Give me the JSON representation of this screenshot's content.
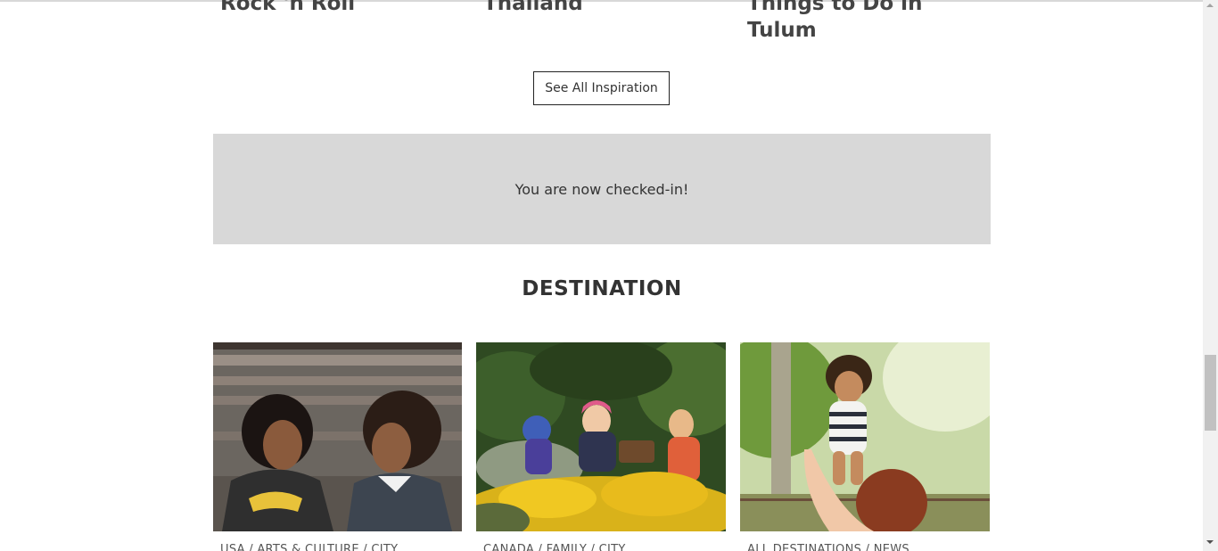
{
  "inspiration": {
    "cards": [
      {
        "title": "Rock 'n Roll"
      },
      {
        "title": "Thailand"
      },
      {
        "title": "Things to Do in Tulum"
      }
    ],
    "see_all_label": "See All Inspiration"
  },
  "banner": {
    "message": "You are now checked-in!"
  },
  "destination": {
    "heading": "DESTINATION",
    "cards": [
      {
        "image": "two-friends-smiling-photo",
        "tags": "USA / ARTS & CULTURE / CITY"
      },
      {
        "image": "kids-in-flower-garden-photo",
        "tags": "CANADA / FAMILY / CITY"
      },
      {
        "image": "mother-lifting-toddler-photo",
        "tags": "ALL DESTINATIONS / NEWS"
      }
    ]
  },
  "colors": {
    "banner_bg": "#d8d8d8",
    "text": "#333333"
  }
}
